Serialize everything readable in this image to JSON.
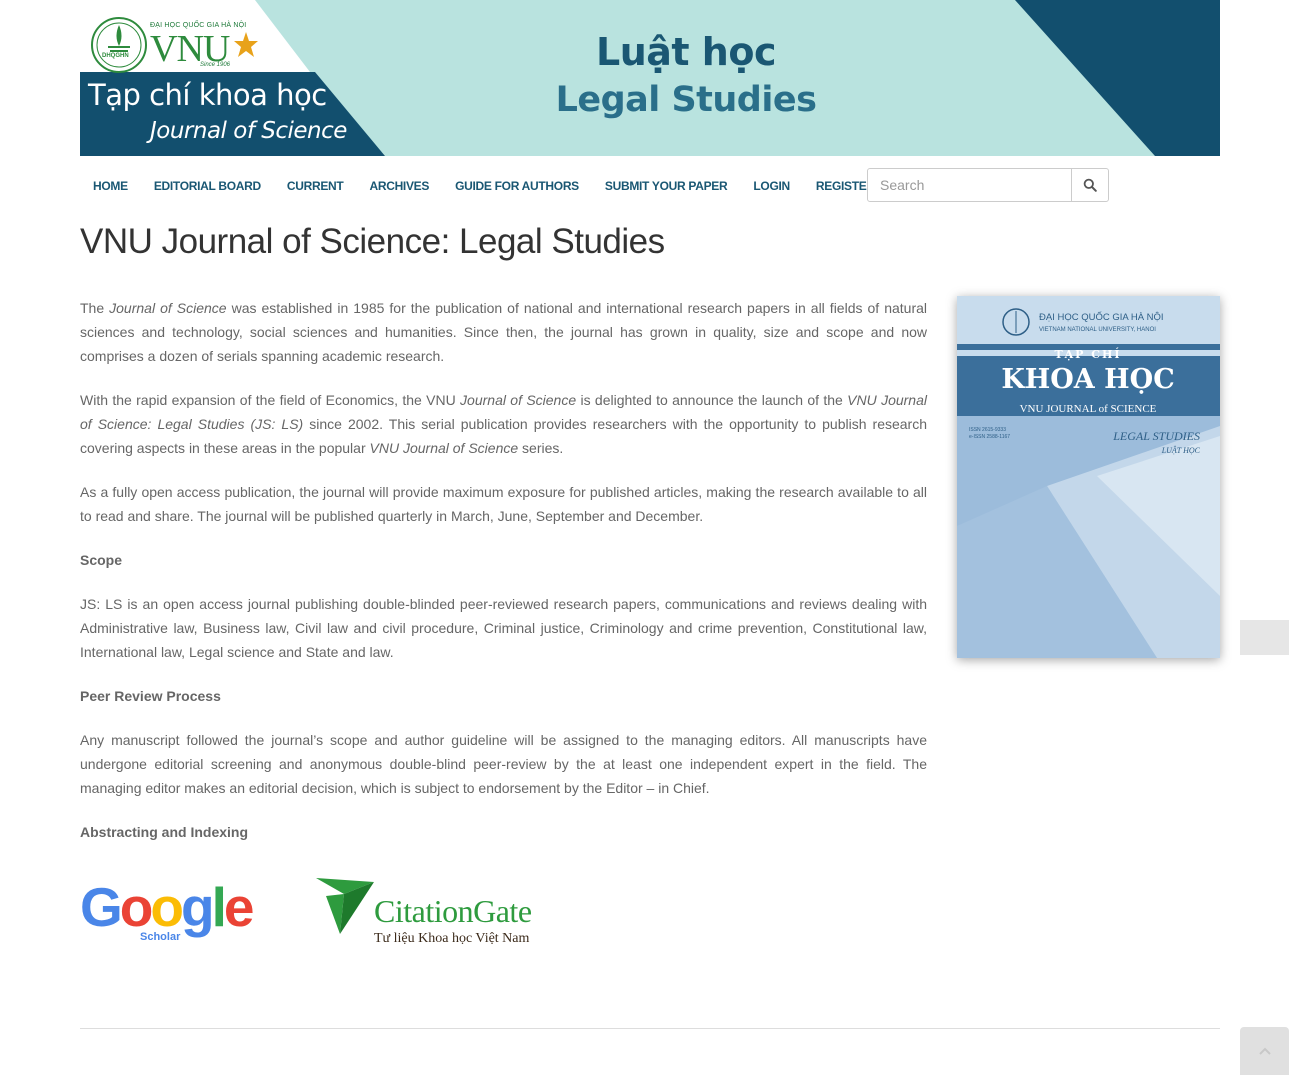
{
  "banner": {
    "vnu_small": "ĐẠI HỌC QUỐC GIA HÀ NỘI",
    "vnu_big": "VNU",
    "since": "Since 1906",
    "seal_text": "DHQGHN",
    "journal_vi": "Tạp chí khoa học",
    "journal_en": "Journal of Science",
    "serial_vi": "Luật học",
    "serial_en": "Legal Studies",
    "colors": {
      "dark": "#124f6e",
      "light": "#b9e3df",
      "green": "#2e8b3d"
    }
  },
  "nav": {
    "items": [
      "HOME",
      "EDITORIAL BOARD",
      "CURRENT",
      "ARCHIVES",
      "GUIDE FOR AUTHORS",
      "SUBMIT YOUR PAPER",
      "LOGIN",
      "REGISTER"
    ],
    "search_placeholder": "Search",
    "search_icon": "search-icon"
  },
  "page_title": "VNU Journal of Science: Legal Studies",
  "intro": {
    "p1_a": "The ",
    "p1_em": "Journal of Science",
    "p1_b": " was established in 1985 for the publication of national and international research papers in all fields of natural sciences and technology, social sciences and humanities. Since then, the journal has grown in quality, size and scope and now comprises a dozen of serials spanning academic research.",
    "p2_a": "With the rapid expansion of the field of Economics, the VNU ",
    "p2_em1": "Journal of Science",
    "p2_b": " is delighted to announce the launch of the ",
    "p2_em2": "VNU Journal of Science: Legal Studies  (JS: LS)",
    "p2_c": " since 2002. This serial publication provides researchers with the opportunity to publish research covering aspects in these areas in the popular ",
    "p2_em3": "VNU Journal of Science",
    "p2_d": " series.",
    "p3": "As a fully open access publication, the journal will provide maximum exposure for published articles, making the research available to all to read and share. The journal will be published quarterly in March, June, September and December."
  },
  "scope": {
    "heading": "Scope",
    "text": "JS: LS is an open access journal publishing double-blinded peer-reviewed research papers, communications and reviews dealing with Administrative law, Business law, Civil law and civil procedure, Criminal justice, Criminology and crime prevention, Constitutional law, International law, Legal science and State and law."
  },
  "peer_review": {
    "heading": "Peer Review Process",
    "text": "Any manuscript followed the journal’s scope and author guideline will be assigned to the managing editors. All manuscripts have undergone editorial screening and anonymous double-blind peer-review by the at least one independent expert in the field. The managing editor makes an editorial decision, which is subject to endorsement by the Editor – in Chief."
  },
  "indexing": {
    "heading": "Abstracting and Indexing",
    "google": "Google",
    "google_sub": "Scholar",
    "citation": "CitationGate",
    "citation_sub": "Tư liệu Khoa học Việt Nam"
  },
  "cover": {
    "univ_vi": "ĐẠI HỌC QUỐC GIA HÀ NỘI",
    "univ_en": "VIETNAM NATIONAL UNIVERSITY, HANOI",
    "tap_chi": "TẠP CHÍ",
    "khoa_hoc": "KHOA HỌC",
    "vnu_jos": "VNU JOURNAL of SCIENCE",
    "issn1": "ISSN 2615-9333",
    "issn2": "e-ISSN 2588-1167",
    "legal": "LEGAL STUDIES",
    "luat": "LUẬT HỌC"
  }
}
